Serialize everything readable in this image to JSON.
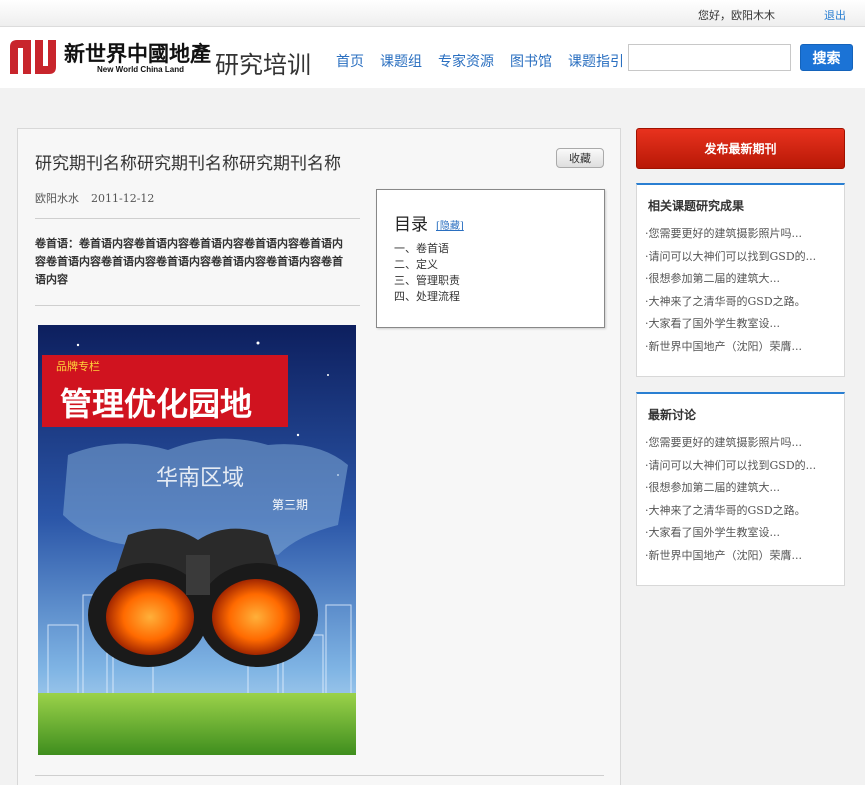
{
  "topbar": {
    "greeting": "您好，欧阳木木",
    "logout": "退出"
  },
  "header": {
    "brand_cn": "新世界中國地產",
    "brand_en": "New World China Land",
    "site_title": "研究培训",
    "nav": [
      "首页",
      "课题组",
      "专家资源",
      "图书馆",
      "课题指引"
    ],
    "search_placeholder": "",
    "search_button": "搜索"
  },
  "article": {
    "title": "研究期刊名称研究期刊名称研究期刊名称",
    "favorite_button": "收藏",
    "author": "欧阳水水",
    "date": "2011-12-12",
    "preface": "卷首语：卷首语内容卷首语内容卷首语内容卷首语内容卷首语内容卷首语内容卷首语内容卷首语内容卷首语内容卷首语内容卷首语内容",
    "toc": {
      "title": "目录",
      "hide_link": "[隐藏]",
      "items": [
        "一、卷首语",
        "二、定义",
        "三、管理职责",
        "四、处理流程"
      ]
    },
    "cover": {
      "top_tag": "品牌专栏",
      "headline": "管理优化园地",
      "subhead": "华南区域",
      "issue": "第三期"
    }
  },
  "sidebar": {
    "publish_button": "发布最新期刊",
    "related": {
      "title": "相关课题研究成果",
      "items": [
        "·您需要更好的建筑摄影照片吗...",
        "·请问可以大神们可以找到GSD的...",
        "·很想参加第二届的建筑大...",
        "·大神来了之清华哥的GSD之路。",
        "·大家看了国外学生教室设...",
        "·新世界中国地产（沈阳）荣膺..."
      ]
    },
    "latest": {
      "title": "最新讨论",
      "items": [
        "·您需要更好的建筑摄影照片吗...",
        "·请问可以大神们可以找到GSD的...",
        "·很想参加第二届的建筑大...",
        "·大神来了之清华哥的GSD之路。",
        "·大家看了国外学生教室设...",
        "·新世界中国地产（沈阳）荣膺..."
      ]
    }
  },
  "colors": {
    "accent_blue": "#1b73d6",
    "link_blue": "#2a6fc0",
    "publish_red": "#d62612",
    "logo_red": "#c8252c"
  }
}
